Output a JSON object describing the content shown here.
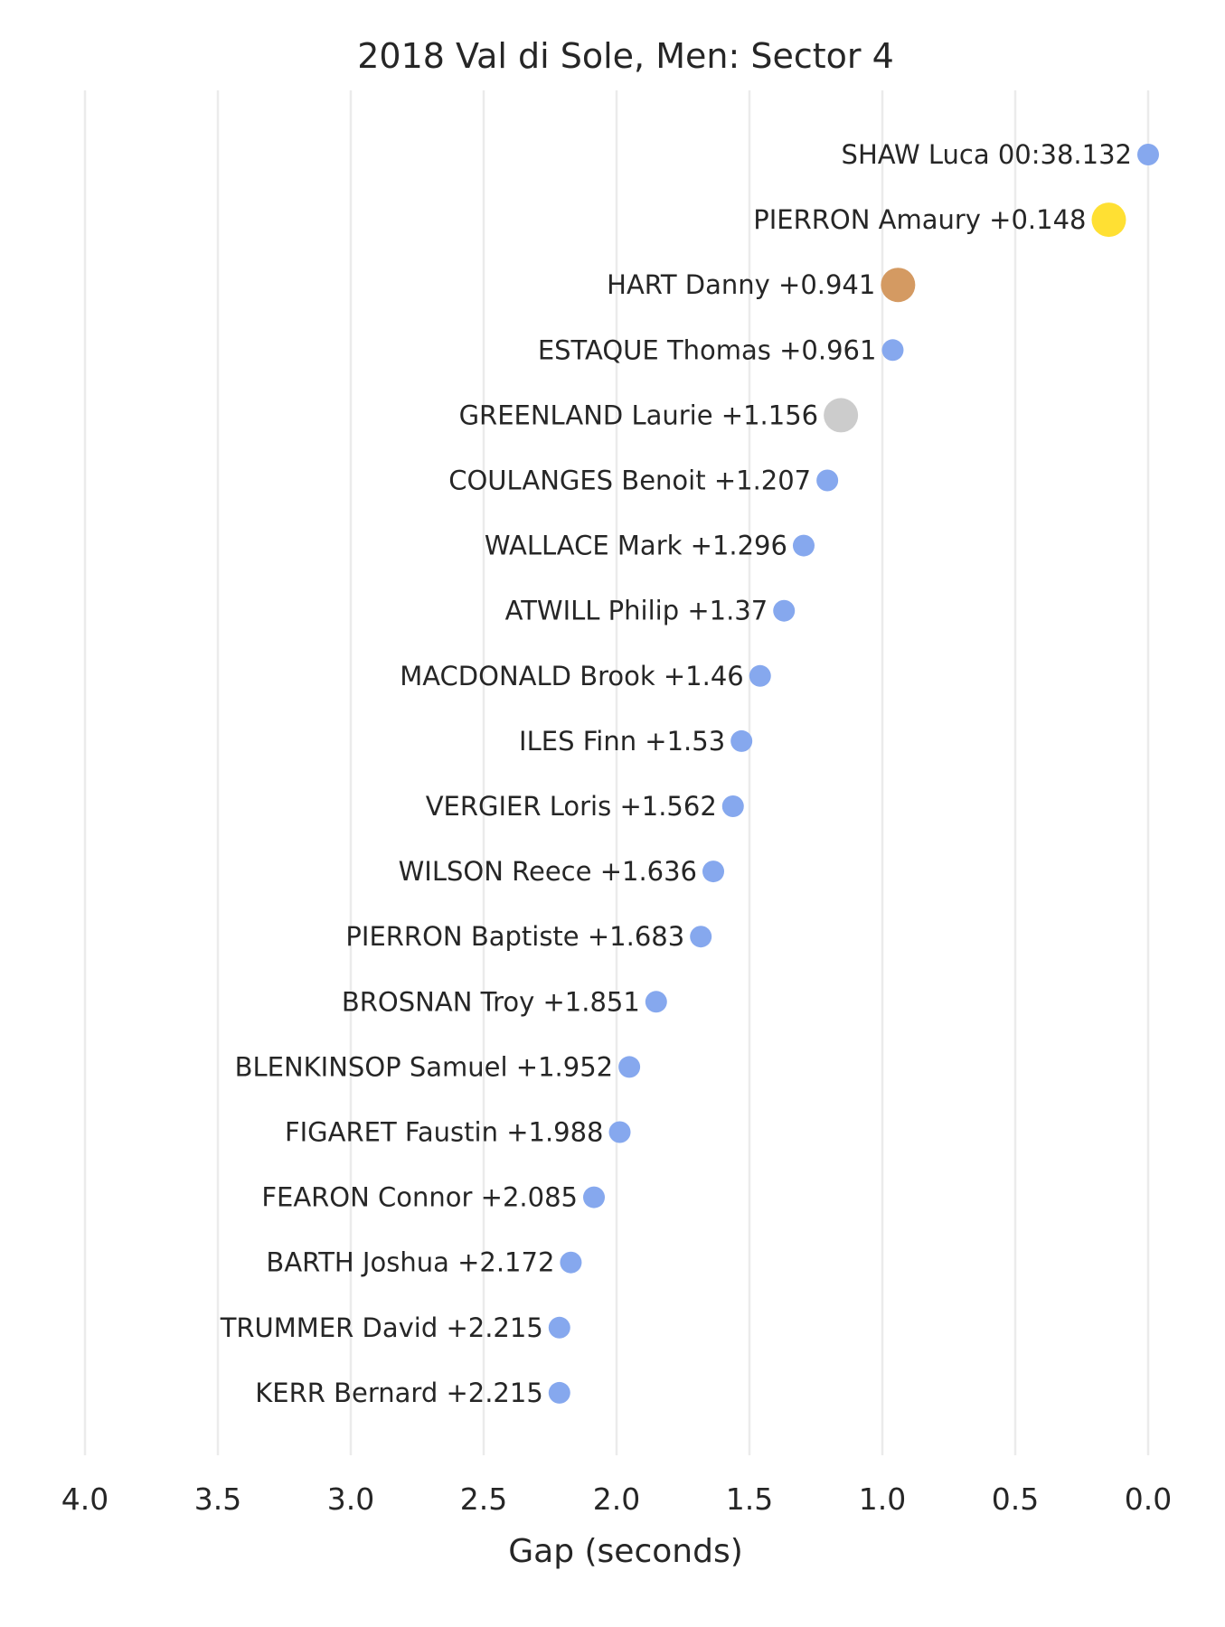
{
  "chart_data": {
    "type": "scatter",
    "title": "2018 Val di Sole, Men: Sector 4",
    "xlabel": "Gap (seconds)",
    "ylabel": "",
    "xlim": [
      4.0,
      0.0
    ],
    "x_inverted": true,
    "xticks": [
      4.0,
      3.5,
      3.0,
      2.5,
      2.0,
      1.5,
      1.0,
      0.5,
      0.0
    ],
    "xtick_labels": [
      "4.0",
      "3.5",
      "3.0",
      "2.5",
      "2.0",
      "1.5",
      "1.0",
      "0.5",
      "0.0"
    ],
    "grid": "vertical",
    "colors": {
      "default": "#86a8ee",
      "gold": "#ffe033",
      "bronze": "#d49a62",
      "silver": "#cccccc"
    },
    "points": [
      {
        "label": "SHAW Luca 00:38.132",
        "gap": 0.0,
        "marker": "default"
      },
      {
        "label": "PIERRON Amaury +0.148",
        "gap": 0.148,
        "marker": "gold"
      },
      {
        "label": "HART Danny +0.941",
        "gap": 0.941,
        "marker": "bronze"
      },
      {
        "label": "ESTAQUE Thomas +0.961",
        "gap": 0.961,
        "marker": "default"
      },
      {
        "label": "GREENLAND Laurie +1.156",
        "gap": 1.156,
        "marker": "silver"
      },
      {
        "label": "COULANGES Benoit +1.207",
        "gap": 1.207,
        "marker": "default"
      },
      {
        "label": "WALLACE Mark +1.296",
        "gap": 1.296,
        "marker": "default"
      },
      {
        "label": "ATWILL Philip +1.37",
        "gap": 1.37,
        "marker": "default"
      },
      {
        "label": "MACDONALD Brook +1.46",
        "gap": 1.46,
        "marker": "default"
      },
      {
        "label": "ILES Finn +1.53",
        "gap": 1.53,
        "marker": "default"
      },
      {
        "label": "VERGIER Loris +1.562",
        "gap": 1.562,
        "marker": "default"
      },
      {
        "label": "WILSON Reece +1.636",
        "gap": 1.636,
        "marker": "default"
      },
      {
        "label": "PIERRON Baptiste +1.683",
        "gap": 1.683,
        "marker": "default"
      },
      {
        "label": "BROSNAN Troy +1.851",
        "gap": 1.851,
        "marker": "default"
      },
      {
        "label": "BLENKINSOP Samuel +1.952",
        "gap": 1.952,
        "marker": "default"
      },
      {
        "label": "FIGARET Faustin +1.988",
        "gap": 1.988,
        "marker": "default"
      },
      {
        "label": "FEARON Connor +2.085",
        "gap": 2.085,
        "marker": "default"
      },
      {
        "label": "BARTH Joshua +2.172",
        "gap": 2.172,
        "marker": "default"
      },
      {
        "label": "TRUMMER David +2.215",
        "gap": 2.215,
        "marker": "default"
      },
      {
        "label": "KERR Bernard +2.215",
        "gap": 2.215,
        "marker": "default"
      }
    ]
  }
}
